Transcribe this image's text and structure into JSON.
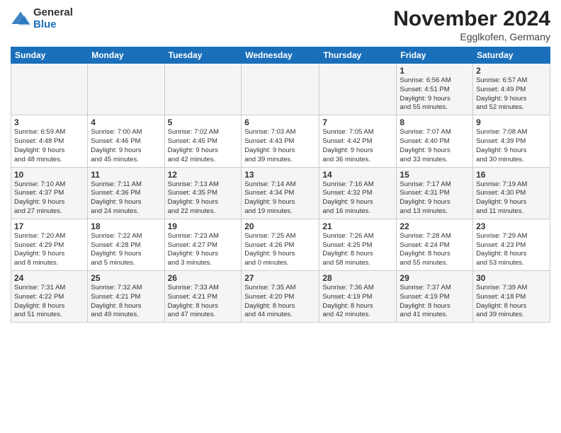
{
  "header": {
    "logo_general": "General",
    "logo_blue": "Blue",
    "month_title": "November 2024",
    "location": "Egglkofen, Germany"
  },
  "weekdays": [
    "Sunday",
    "Monday",
    "Tuesday",
    "Wednesday",
    "Thursday",
    "Friday",
    "Saturday"
  ],
  "rows": [
    [
      {
        "day": "",
        "info": ""
      },
      {
        "day": "",
        "info": ""
      },
      {
        "day": "",
        "info": ""
      },
      {
        "day": "",
        "info": ""
      },
      {
        "day": "",
        "info": ""
      },
      {
        "day": "1",
        "info": "Sunrise: 6:56 AM\nSunset: 4:51 PM\nDaylight: 9 hours\nand 55 minutes."
      },
      {
        "day": "2",
        "info": "Sunrise: 6:57 AM\nSunset: 4:49 PM\nDaylight: 9 hours\nand 52 minutes."
      }
    ],
    [
      {
        "day": "3",
        "info": "Sunrise: 6:59 AM\nSunset: 4:48 PM\nDaylight: 9 hours\nand 48 minutes."
      },
      {
        "day": "4",
        "info": "Sunrise: 7:00 AM\nSunset: 4:46 PM\nDaylight: 9 hours\nand 45 minutes."
      },
      {
        "day": "5",
        "info": "Sunrise: 7:02 AM\nSunset: 4:45 PM\nDaylight: 9 hours\nand 42 minutes."
      },
      {
        "day": "6",
        "info": "Sunrise: 7:03 AM\nSunset: 4:43 PM\nDaylight: 9 hours\nand 39 minutes."
      },
      {
        "day": "7",
        "info": "Sunrise: 7:05 AM\nSunset: 4:42 PM\nDaylight: 9 hours\nand 36 minutes."
      },
      {
        "day": "8",
        "info": "Sunrise: 7:07 AM\nSunset: 4:40 PM\nDaylight: 9 hours\nand 33 minutes."
      },
      {
        "day": "9",
        "info": "Sunrise: 7:08 AM\nSunset: 4:39 PM\nDaylight: 9 hours\nand 30 minutes."
      }
    ],
    [
      {
        "day": "10",
        "info": "Sunrise: 7:10 AM\nSunset: 4:37 PM\nDaylight: 9 hours\nand 27 minutes."
      },
      {
        "day": "11",
        "info": "Sunrise: 7:11 AM\nSunset: 4:36 PM\nDaylight: 9 hours\nand 24 minutes."
      },
      {
        "day": "12",
        "info": "Sunrise: 7:13 AM\nSunset: 4:35 PM\nDaylight: 9 hours\nand 22 minutes."
      },
      {
        "day": "13",
        "info": "Sunrise: 7:14 AM\nSunset: 4:34 PM\nDaylight: 9 hours\nand 19 minutes."
      },
      {
        "day": "14",
        "info": "Sunrise: 7:16 AM\nSunset: 4:32 PM\nDaylight: 9 hours\nand 16 minutes."
      },
      {
        "day": "15",
        "info": "Sunrise: 7:17 AM\nSunset: 4:31 PM\nDaylight: 9 hours\nand 13 minutes."
      },
      {
        "day": "16",
        "info": "Sunrise: 7:19 AM\nSunset: 4:30 PM\nDaylight: 9 hours\nand 11 minutes."
      }
    ],
    [
      {
        "day": "17",
        "info": "Sunrise: 7:20 AM\nSunset: 4:29 PM\nDaylight: 9 hours\nand 8 minutes."
      },
      {
        "day": "18",
        "info": "Sunrise: 7:22 AM\nSunset: 4:28 PM\nDaylight: 9 hours\nand 5 minutes."
      },
      {
        "day": "19",
        "info": "Sunrise: 7:23 AM\nSunset: 4:27 PM\nDaylight: 9 hours\nand 3 minutes."
      },
      {
        "day": "20",
        "info": "Sunrise: 7:25 AM\nSunset: 4:26 PM\nDaylight: 9 hours\nand 0 minutes."
      },
      {
        "day": "21",
        "info": "Sunrise: 7:26 AM\nSunset: 4:25 PM\nDaylight: 8 hours\nand 58 minutes."
      },
      {
        "day": "22",
        "info": "Sunrise: 7:28 AM\nSunset: 4:24 PM\nDaylight: 8 hours\nand 55 minutes."
      },
      {
        "day": "23",
        "info": "Sunrise: 7:29 AM\nSunset: 4:23 PM\nDaylight: 8 hours\nand 53 minutes."
      }
    ],
    [
      {
        "day": "24",
        "info": "Sunrise: 7:31 AM\nSunset: 4:22 PM\nDaylight: 8 hours\nand 51 minutes."
      },
      {
        "day": "25",
        "info": "Sunrise: 7:32 AM\nSunset: 4:21 PM\nDaylight: 8 hours\nand 49 minutes."
      },
      {
        "day": "26",
        "info": "Sunrise: 7:33 AM\nSunset: 4:21 PM\nDaylight: 8 hours\nand 47 minutes."
      },
      {
        "day": "27",
        "info": "Sunrise: 7:35 AM\nSunset: 4:20 PM\nDaylight: 8 hours\nand 44 minutes."
      },
      {
        "day": "28",
        "info": "Sunrise: 7:36 AM\nSunset: 4:19 PM\nDaylight: 8 hours\nand 42 minutes."
      },
      {
        "day": "29",
        "info": "Sunrise: 7:37 AM\nSunset: 4:19 PM\nDaylight: 8 hours\nand 41 minutes."
      },
      {
        "day": "30",
        "info": "Sunrise: 7:39 AM\nSunset: 4:18 PM\nDaylight: 8 hours\nand 39 minutes."
      }
    ]
  ]
}
